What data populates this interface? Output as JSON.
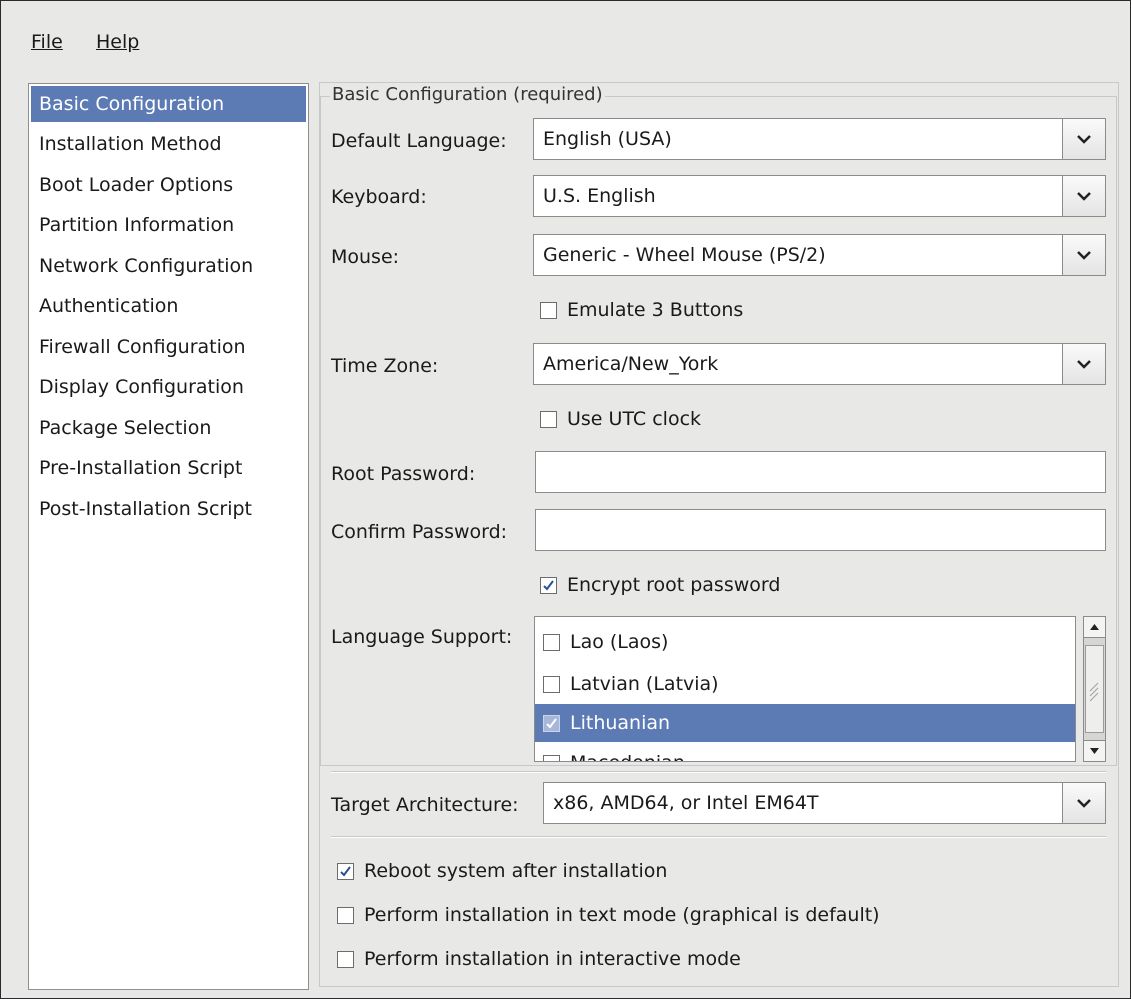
{
  "menubar": {
    "file_label": "File",
    "help_label": "Help"
  },
  "sidebar": {
    "items": [
      {
        "label": "Basic Configuration",
        "selected": true
      },
      {
        "label": "Installation Method"
      },
      {
        "label": "Boot Loader Options"
      },
      {
        "label": "Partition Information"
      },
      {
        "label": "Network Configuration"
      },
      {
        "label": "Authentication"
      },
      {
        "label": "Firewall Configuration"
      },
      {
        "label": "Display Configuration"
      },
      {
        "label": "Package Selection"
      },
      {
        "label": "Pre-Installation Script"
      },
      {
        "label": "Post-Installation Script"
      }
    ]
  },
  "main": {
    "group_title": "Basic Configuration (required)",
    "default_language": {
      "label": "Default Language:",
      "value": "English (USA)"
    },
    "keyboard": {
      "label": "Keyboard:",
      "value": "U.S. English"
    },
    "mouse": {
      "label": "Mouse:",
      "value": "Generic - Wheel Mouse (PS/2)"
    },
    "emulate_buttons": {
      "label": "Emulate 3 Buttons",
      "checked": false
    },
    "time_zone": {
      "label": "Time Zone:",
      "value": "America/New_York"
    },
    "utc_clock": {
      "label": "Use UTC clock",
      "checked": false
    },
    "root_password": {
      "label": "Root Password:",
      "value": ""
    },
    "confirm_password": {
      "label": "Confirm Password:",
      "value": ""
    },
    "encrypt_root": {
      "label": "Encrypt root password",
      "checked": true
    },
    "language_support": {
      "label": "Language Support:",
      "items": [
        {
          "label": "Lao (Laos)",
          "checked": false
        },
        {
          "label": "Latvian (Latvia)",
          "checked": false
        },
        {
          "label": "Lithuanian",
          "checked": true,
          "selected": true
        },
        {
          "label": "Macedonian",
          "checked": false
        }
      ]
    },
    "target_architecture": {
      "label": "Target Architecture:",
      "value": "x86, AMD64, or Intel EM64T"
    },
    "reboot": {
      "label": "Reboot system after installation",
      "checked": true
    },
    "text_mode": {
      "label": "Perform installation in text mode (graphical is default)",
      "checked": false
    },
    "interactive": {
      "label": "Perform installation in interactive mode",
      "checked": false
    }
  },
  "colors": {
    "selection": "#5c7bb5",
    "window_bg": "#e8e8e7"
  }
}
